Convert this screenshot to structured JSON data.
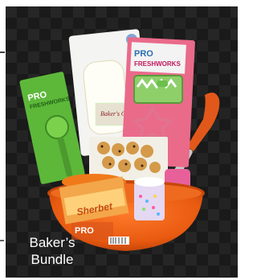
{
  "caption": {
    "line1": "Baker’s",
    "line2": "Bundle"
  },
  "packaging": {
    "brand_left": "PRO",
    "brand_left_sub": "FRESHWORKS",
    "brand_right": "PRO",
    "brand_right_sub": "FRESHWORKS",
    "bowl_brand": "PRO",
    "mix_label": "Sherbet",
    "scraper_label": "Baker's Corner"
  }
}
